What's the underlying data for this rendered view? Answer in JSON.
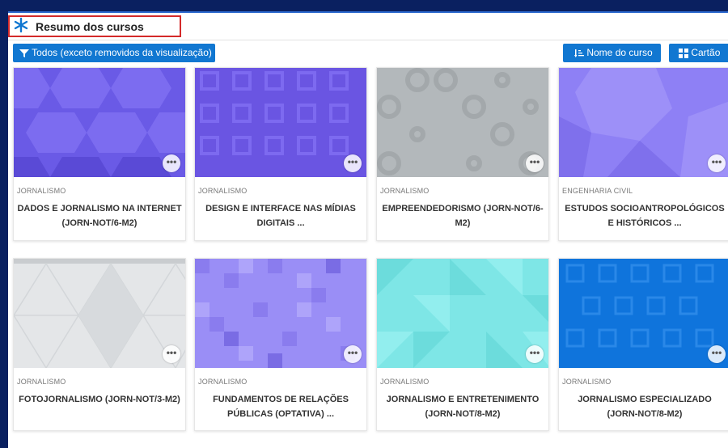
{
  "header": {
    "title": "Resumo dos cursos"
  },
  "toolbar": {
    "filter_label": "Todos (exceto removidos da visualização)",
    "sort_label": "Nome do curso",
    "view_label": "Cartão"
  },
  "colors": {
    "accent": "#1177d1",
    "title_highlight": "#d42a2a",
    "background": "#0a2060"
  },
  "courses": [
    {
      "category": "JORNALISMO",
      "name": "DADOS E JORNALISMO NA INTERNET (JORN-NOT/6-M2)",
      "more": "•••"
    },
    {
      "category": "JORNALISMO",
      "name": "DESIGN E INTERFACE NAS MÍDIAS DIGITAIS ...",
      "more": "•••"
    },
    {
      "category": "JORNALISMO",
      "name": "EMPREENDEDORISMO (JORN-NOT/6-M2)",
      "more": "•••"
    },
    {
      "category": "ENGENHARIA CIVIL",
      "name": "ESTUDOS SOCIOANTROPOLÓGICOS E HISTÓRICOS ...",
      "more": "•••"
    },
    {
      "category": "JORNALISMO",
      "name": "FOTOJORNALISMO (JORN-NOT/3-M2)",
      "more": "•••"
    },
    {
      "category": "JORNALISMO",
      "name": "FUNDAMENTOS DE RELAÇÕES PÚBLICAS (OPTATIVA) ...",
      "more": "•••"
    },
    {
      "category": "JORNALISMO",
      "name": "JORNALISMO E ENTRETENIMENTO (JORN-NOT/8-M2)",
      "more": "•••"
    },
    {
      "category": "JORNALISMO",
      "name": "JORNALISMO ESPECIALIZADO (JORN-NOT/8-M2)",
      "more": "•••"
    }
  ]
}
